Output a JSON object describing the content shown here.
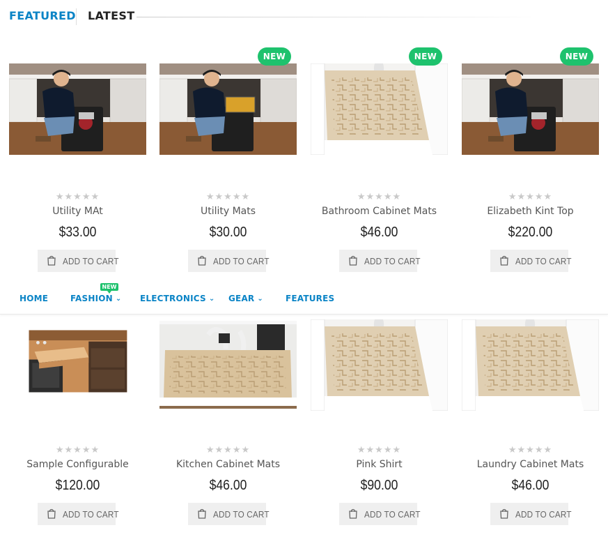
{
  "tabs": {
    "featured": "FEATURED",
    "latest": "LATEST"
  },
  "nav": {
    "items": [
      {
        "label": "HOME",
        "has_dropdown": false
      },
      {
        "label": "FASHION",
        "has_dropdown": true,
        "badge": "NEW"
      },
      {
        "label": "ELECTRONICS",
        "has_dropdown": true
      },
      {
        "label": "GEAR",
        "has_dropdown": true
      },
      {
        "label": "FEATURES",
        "has_dropdown": false
      }
    ]
  },
  "rating_stars": "★★★★★",
  "add_to_cart_label": "ADD TO CART",
  "new_badge": "NEW",
  "colors": {
    "accent": "#0b84c6",
    "badge": "#1ec26d",
    "button_bg": "#efefef",
    "stars": "#c9c9c9"
  },
  "products_row1": [
    {
      "name": "Utility MAt",
      "price": "$33.00",
      "is_new": false,
      "image": "plumber-with-mat"
    },
    {
      "name": "Utility Mats",
      "price": "$30.00",
      "is_new": true,
      "image": "plumber-with-toolbox"
    },
    {
      "name": "Bathroom Cabinet Mats",
      "price": "$46.00",
      "is_new": true,
      "image": "beige-cabinet-mat"
    },
    {
      "name": "Elizabeth Kint Top",
      "price": "$220.00",
      "is_new": true,
      "image": "plumber-with-mat"
    }
  ],
  "products_row2": [
    {
      "name": "Sample Configurable",
      "price": "$120.00",
      "is_new": false,
      "image": "pull-out-shelf"
    },
    {
      "name": "Kitchen Cabinet Mats",
      "price": "$46.00",
      "is_new": true,
      "image": "under-sink-mat"
    },
    {
      "name": "Pink Shirt",
      "price": "$90.00",
      "is_new": false,
      "image": "beige-cabinet-mat"
    },
    {
      "name": "Laundry Cabinet Mats",
      "price": "$46.00",
      "is_new": true,
      "image": "beige-cabinet-mat"
    }
  ]
}
